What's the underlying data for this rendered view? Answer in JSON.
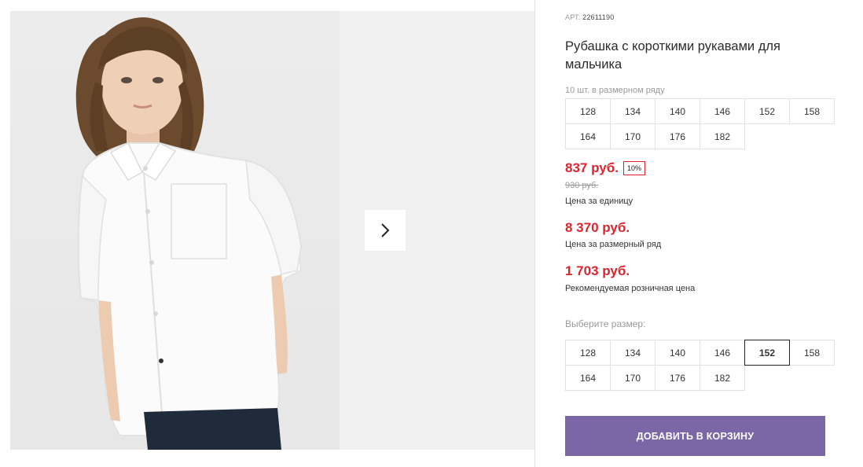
{
  "gallery": {
    "next_button_icon": "chevron-right-icon"
  },
  "product": {
    "sku_label": "АРТ.",
    "sku_value": "22611190",
    "title": "Рубашка с короткими рукавами для мальчика",
    "pack_note": "10 шт. в размерном ряду",
    "pack_sizes": [
      "128",
      "134",
      "140",
      "146",
      "152",
      "158",
      "164",
      "170",
      "176",
      "182"
    ],
    "price": {
      "unit_price": "837 руб.",
      "discount_badge": "10%",
      "old_price": "930 руб.",
      "unit_caption": "Цена за единицу",
      "pack_price": "8 370 руб.",
      "pack_caption": "Цена за размерный ряд",
      "retail_price": "1 703 руб.",
      "retail_caption": "Рекомендуемая розничная цена",
      "accent_color": "#e1222d"
    },
    "size_select": {
      "label": "Выберите размер:",
      "sizes": [
        "128",
        "134",
        "140",
        "146",
        "152",
        "158",
        "164",
        "170",
        "176",
        "182"
      ],
      "selected": "152"
    },
    "add_to_cart_label": "ДОБАВИТЬ В КОРЗИНУ",
    "button_color": "#7b67a6"
  }
}
